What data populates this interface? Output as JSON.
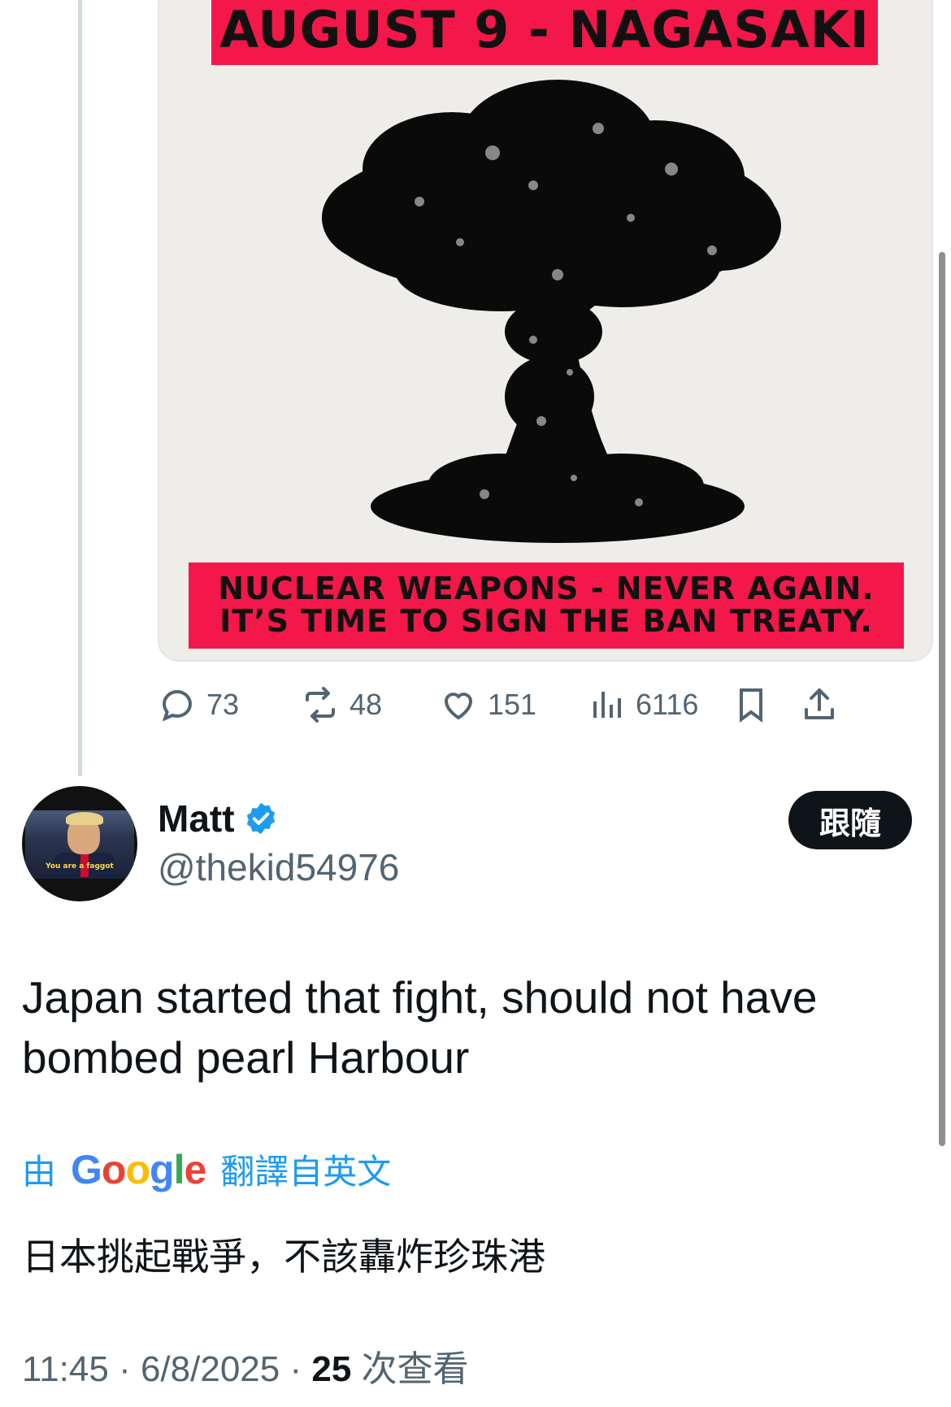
{
  "media": {
    "banner_top": "AUGUST 9 - NAGASAKI",
    "banner_bottom_line1": "NUCLEAR WEAPONS - NEVER AGAIN.",
    "banner_bottom_line2": "IT’S TIME TO SIGN THE BAN TREATY.",
    "banner_color": "#f4174a"
  },
  "actions": {
    "replies": "73",
    "reposts": "48",
    "likes": "151",
    "views": "6116"
  },
  "reply": {
    "display_name": "Matt",
    "handle": "@thekid54976",
    "follow_label": "跟隨",
    "avatar_caption": "You are a faggot",
    "text": "Japan started that fight, should not have bombed pearl Harbour",
    "translate_prefix": "由",
    "google_letters": [
      "G",
      "o",
      "o",
      "g",
      "l",
      "e"
    ],
    "translate_suffix": "翻譯自英文",
    "translated_text": "日本挑起戰爭，不該轟炸珍珠港",
    "time": "11:45",
    "date": "6/8/2025",
    "views_count": "25",
    "views_label": "次查看"
  },
  "colors": {
    "accent": "#1d9bf0",
    "text_primary": "#0f1419",
    "text_secondary": "#536471"
  }
}
